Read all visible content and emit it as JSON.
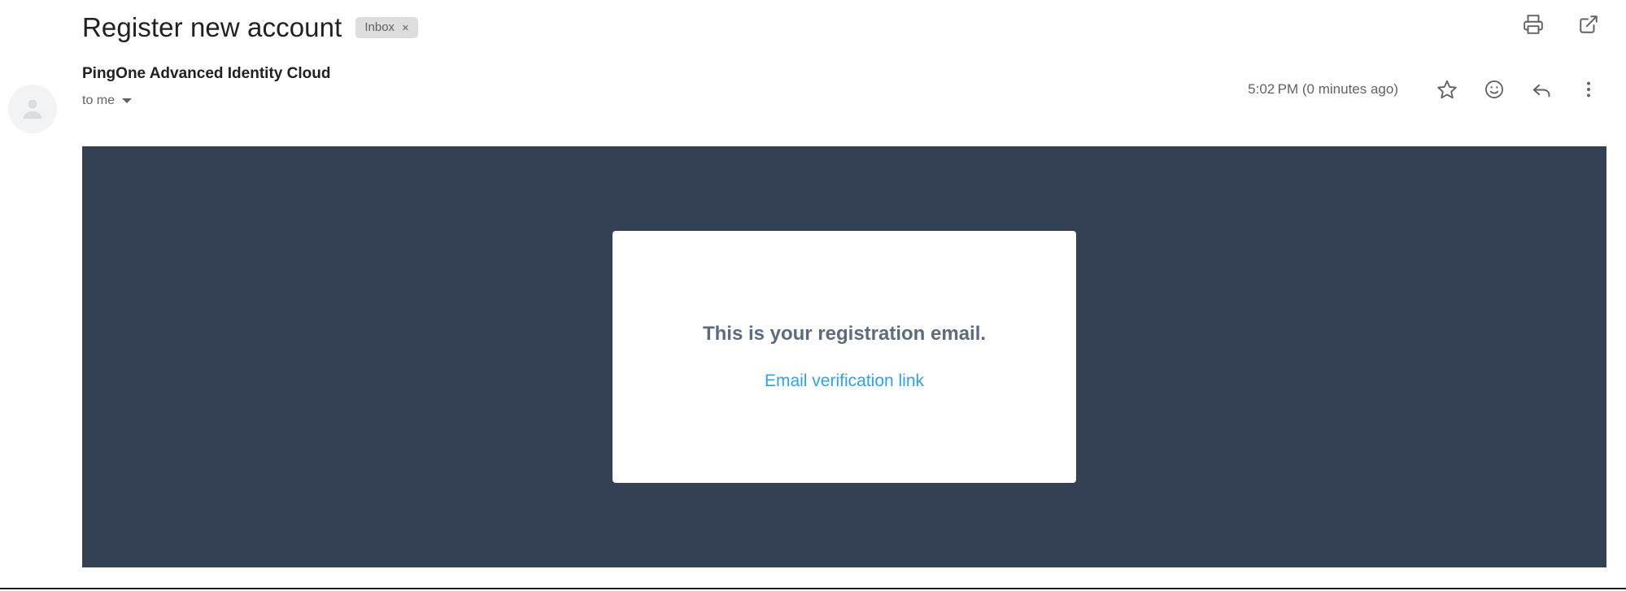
{
  "subject": {
    "title": "Register new account",
    "label": "Inbox",
    "label_remove": "×"
  },
  "subject_actions": [
    {
      "name": "print-icon",
      "tooltip": "Print all"
    },
    {
      "name": "open-in-new-window-icon",
      "tooltip": "In new window"
    }
  ],
  "sender": {
    "name": "PingOne Advanced Identity Cloud",
    "recipient": "to me",
    "avatar": "person-avatar-icon"
  },
  "meta": {
    "timestamp": "5:02 PM (0 minutes ago)"
  },
  "meta_actions": [
    {
      "name": "star-icon",
      "tooltip": "Not starred"
    },
    {
      "name": "add-reaction-icon",
      "tooltip": "Add emoji reaction"
    },
    {
      "name": "reply-icon",
      "tooltip": "Reply"
    },
    {
      "name": "more-options-icon",
      "tooltip": "More"
    }
  ],
  "email_body": {
    "background_color": "#344154",
    "card": {
      "background_color": "#ffffff",
      "heading": "This is your registration email.",
      "link_text": "Email verification link",
      "link_color": "#2ba3f2",
      "heading_color": "#5b6b80"
    }
  }
}
